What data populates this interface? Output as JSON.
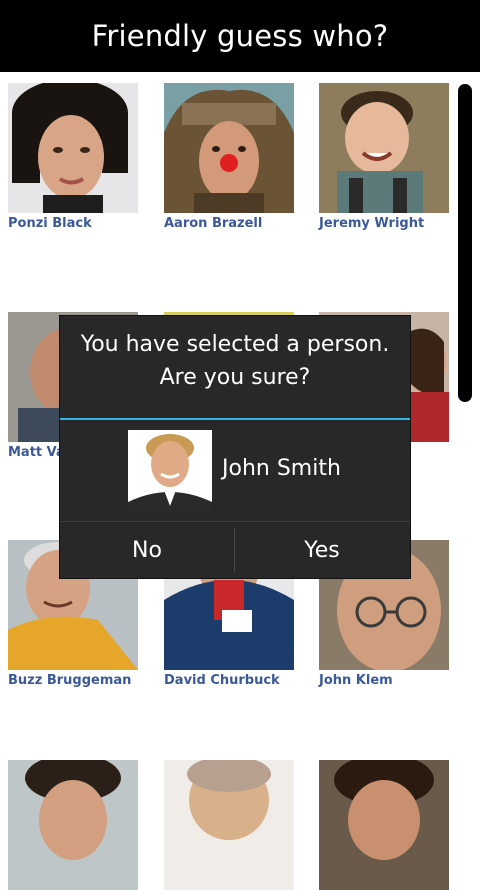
{
  "app": {
    "title": "Friendly guess who?"
  },
  "people": [
    {
      "name": "Ponzi Black"
    },
    {
      "name": "Aaron Brazell"
    },
    {
      "name": "Jeremy Wright"
    },
    {
      "name": "Matt Va"
    },
    {
      "name": ""
    },
    {
      "name": ""
    },
    {
      "name": "Buzz Bruggeman"
    },
    {
      "name": "David Churbuck"
    },
    {
      "name": "John Klem"
    }
  ],
  "dialog": {
    "message_line1": "You have selected a person.",
    "message_line2": "Are you sure?",
    "selected_person": "John Smith",
    "no_label": "No",
    "yes_label": "Yes",
    "accent_color": "#33b5e5"
  }
}
